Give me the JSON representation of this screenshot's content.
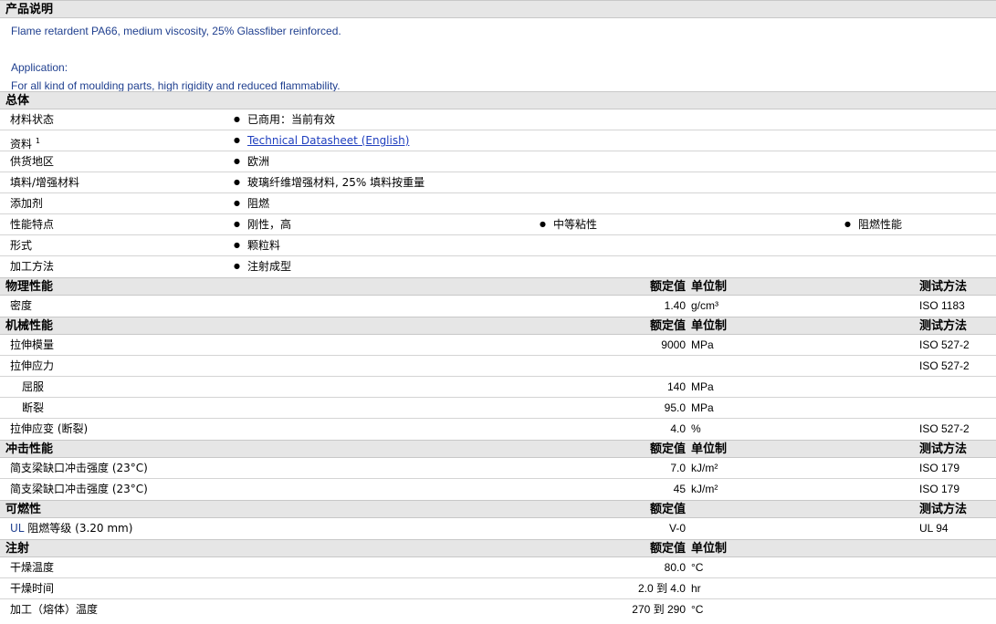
{
  "description": {
    "title": "产品说明",
    "line1": "Flame retardent PA66, medium viscosity, 25% Glassfiber reinforced.",
    "app_label": "Application:",
    "app_text": "For all kind of moulding parts, high rigidity and reduced flammability."
  },
  "general": {
    "title": "总体",
    "rows": [
      {
        "label": "材料状态",
        "values": [
          "已商用：当前有效"
        ]
      },
      {
        "label": "资料",
        "sup": "1",
        "values": [
          "Technical Datasheet (English)"
        ]
      },
      {
        "label": "供货地区",
        "values": [
          "欧洲"
        ]
      },
      {
        "label": "填料/增强材料",
        "values": [
          "玻璃纤维增强材料, 25% 填料按重量"
        ]
      },
      {
        "label": "添加剂",
        "values": [
          "阻燃"
        ]
      },
      {
        "label": "性能特点",
        "values": [
          "刚性，高",
          "中等粘性",
          "阻燃性能"
        ]
      },
      {
        "label": "形式",
        "values": [
          "颗粒料"
        ]
      },
      {
        "label": "加工方法",
        "values": [
          "注射成型"
        ]
      }
    ]
  },
  "headers": {
    "nominal": "额定值",
    "unit": "单位制",
    "method": "测试方法"
  },
  "physical": {
    "title": "物理性能",
    "rows": [
      {
        "label": "密度",
        "value": "1.40",
        "unit": "g/cm³",
        "method": "ISO 1183"
      }
    ]
  },
  "mechanical": {
    "title": "机械性能",
    "rows": [
      {
        "label": "拉伸模量",
        "value": "9000",
        "unit": "MPa",
        "method": "ISO 527-2"
      },
      {
        "label": "拉伸应力",
        "value": "",
        "unit": "",
        "method": "ISO 527-2"
      },
      {
        "label": "屈服",
        "value": "140",
        "unit": "MPa",
        "method": ""
      },
      {
        "label": "断裂",
        "value": "95.0",
        "unit": "MPa",
        "method": ""
      },
      {
        "label": "拉伸应变 (断裂)",
        "value": "4.0",
        "unit": "%",
        "method": "ISO 527-2"
      }
    ]
  },
  "impact": {
    "title": "冲击性能",
    "rows": [
      {
        "label": "简支梁缺口冲击强度 (23°C)",
        "value": "7.0",
        "unit": "kJ/m²",
        "method": "ISO 179"
      },
      {
        "label": "简支梁缺口冲击强度 (23°C)",
        "value": "45",
        "unit": "kJ/m²",
        "method": "ISO 179"
      }
    ]
  },
  "flammability": {
    "title": "可燃性",
    "rows": [
      {
        "label_prefix": "UL",
        "label": "阻燃等级",
        "label_suffix": "(3.20 mm)",
        "value": "V-0",
        "unit": "",
        "method": "UL 94"
      }
    ]
  },
  "injection": {
    "title": "注射",
    "rows": [
      {
        "label": "干燥温度",
        "value": "80.0",
        "unit": "°C",
        "method": ""
      },
      {
        "label": "干燥时间",
        "value": "2.0 到  4.0",
        "unit": "hr",
        "method": ""
      },
      {
        "label": "加工（熔体）温度",
        "value": "270 到  290",
        "unit": "°C",
        "method": ""
      }
    ]
  }
}
